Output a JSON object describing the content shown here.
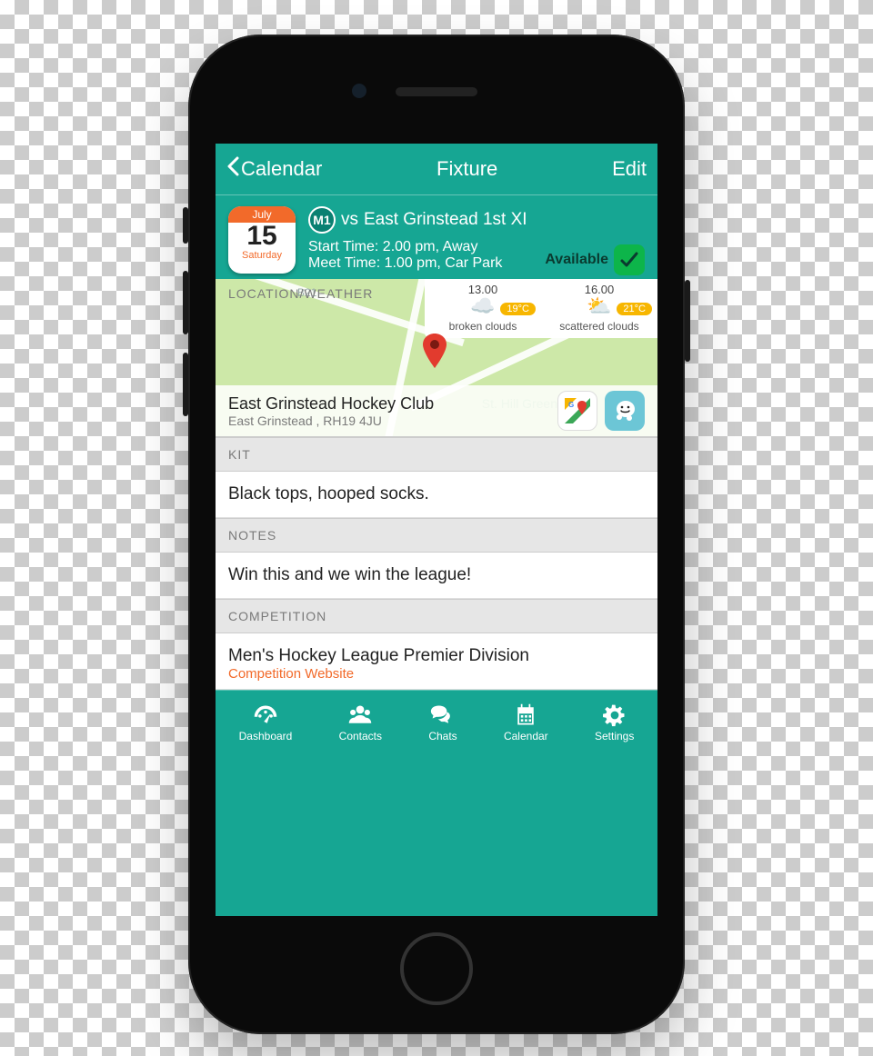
{
  "nav": {
    "back": "Calendar",
    "title": "Fixture",
    "edit": "Edit"
  },
  "calendar_icon": {
    "month": "July",
    "day": "15",
    "weekday": "Saturday"
  },
  "fixture": {
    "team_badge": "M1",
    "versus_prefix": "vs",
    "opponent": "East Grinstead 1st XI",
    "start_line": "Start Time: 2.00 pm, Away",
    "meet_line": "Meet Time: 1.00 pm, Car Park",
    "availability_label": "Available"
  },
  "sections": {
    "location": "LOCATION/WEATHER",
    "kit": "KIT",
    "notes": "NOTES",
    "competition": "COMPETITION"
  },
  "weather": [
    {
      "time": "13.00",
      "temp": "19°C",
      "desc": "broken clouds"
    },
    {
      "time": "16.00",
      "temp": "21°C",
      "desc": "scattered clouds"
    }
  ],
  "location": {
    "name": "East Grinstead Hockey Club",
    "address": "East Grinstead , RH19 4JU",
    "map_label": "St. Hill Green",
    "road_label": "B21"
  },
  "kit_text": "Black tops, hooped socks.",
  "notes_text": "Win this and we win the league!",
  "competition": {
    "name": "Men's Hockey League Premier Division",
    "link": "Competition Website"
  },
  "tabs": [
    {
      "label": "Dashboard"
    },
    {
      "label": "Contacts"
    },
    {
      "label": "Chats"
    },
    {
      "label": "Calendar"
    },
    {
      "label": "Settings"
    }
  ]
}
